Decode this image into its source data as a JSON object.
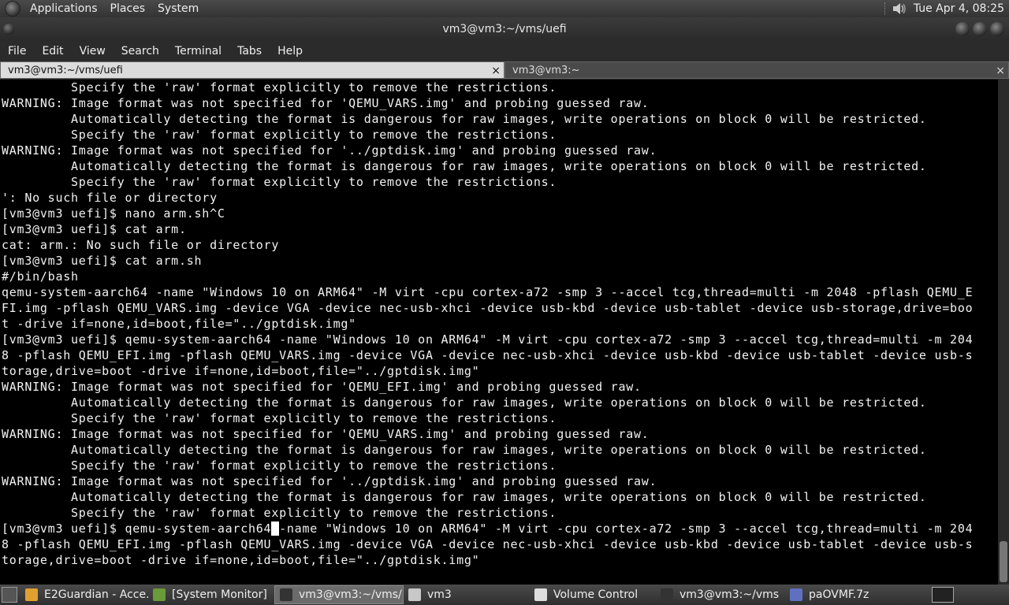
{
  "top_panel": {
    "menus": [
      "Applications",
      "Places",
      "System"
    ],
    "clock": "Tue Apr  4, 08:25",
    "icons": [
      "gnome-foot-icon",
      "speaker-icon"
    ]
  },
  "window": {
    "title": "vm3@vm3:~/vms/uefi"
  },
  "menubar": [
    "File",
    "Edit",
    "View",
    "Search",
    "Terminal",
    "Tabs",
    "Help"
  ],
  "tabs": [
    {
      "label": "vm3@vm3:~/vms/uefi",
      "close": "×"
    },
    {
      "label": "vm3@vm3:~",
      "close": "×"
    }
  ],
  "terminal": {
    "lines": [
      "         Specify the 'raw' format explicitly to remove the restrictions.",
      "WARNING: Image format was not specified for 'QEMU_VARS.img' and probing guessed raw.",
      "         Automatically detecting the format is dangerous for raw images, write operations on block 0 will be restricted.",
      "         Specify the 'raw' format explicitly to remove the restrictions.",
      "WARNING: Image format was not specified for '../gptdisk.img' and probing guessed raw.",
      "         Automatically detecting the format is dangerous for raw images, write operations on block 0 will be restricted.",
      "         Specify the 'raw' format explicitly to remove the restrictions.",
      "': No such file or directory",
      "[vm3@vm3 uefi]$ nano arm.sh^C",
      "[vm3@vm3 uefi]$ cat arm.",
      "cat: arm.: No such file or directory",
      "[vm3@vm3 uefi]$ cat arm.sh",
      "#/bin/bash",
      "qemu-system-aarch64 -name \"Windows 10 on ARM64\" -M virt -cpu cortex-a72 -smp 3 --accel tcg,thread=multi -m 2048 -pflash QEMU_E",
      "FI.img -pflash QEMU_VARS.img -device VGA -device nec-usb-xhci -device usb-kbd -device usb-tablet -device usb-storage,drive=boo",
      "t -drive if=none,id=boot,file=\"../gptdisk.img\"",
      "[vm3@vm3 uefi]$ qemu-system-aarch64 -name \"Windows 10 on ARM64\" -M virt -cpu cortex-a72 -smp 3 --accel tcg,thread=multi -m 204",
      "8 -pflash QEMU_EFI.img -pflash QEMU_VARS.img -device VGA -device nec-usb-xhci -device usb-kbd -device usb-tablet -device usb-s",
      "torage,drive=boot -drive if=none,id=boot,file=\"../gptdisk.img\"",
      "WARNING: Image format was not specified for 'QEMU_EFI.img' and probing guessed raw.",
      "         Automatically detecting the format is dangerous for raw images, write operations on block 0 will be restricted.",
      "         Specify the 'raw' format explicitly to remove the restrictions.",
      "WARNING: Image format was not specified for 'QEMU_VARS.img' and probing guessed raw.",
      "         Automatically detecting the format is dangerous for raw images, write operations on block 0 will be restricted.",
      "         Specify the 'raw' format explicitly to remove the restrictions.",
      "WARNING: Image format was not specified for '../gptdisk.img' and probing guessed raw.",
      "         Automatically detecting the format is dangerous for raw images, write operations on block 0 will be restricted.",
      "         Specify the 'raw' format explicitly to remove the restrictions."
    ],
    "cursor_line": {
      "before": "[vm3@vm3 uefi]$ qemu-system-aarch64",
      "cursor": " ",
      "after": "-name \"Windows 10 on ARM64\" -M virt -cpu cortex-a72 -smp 3 --accel tcg,thread=multi -m 204"
    },
    "tail_lines": [
      "8 -pflash QEMU_EFI.img -pflash QEMU_VARS.img -device VGA -device nec-usb-xhci -device usb-kbd -device usb-tablet -device usb-s",
      "torage,drive=boot -drive if=none,id=boot,file=\"../gptdisk.img\""
    ]
  },
  "taskbar": {
    "items": [
      {
        "label": "E2Guardian - Acce...",
        "icon": "chrome-icon",
        "color": "#e0a030"
      },
      {
        "label": "[System Monitor]",
        "icon": "system-monitor-icon",
        "color": "#6a9a3a"
      },
      {
        "label": "vm3@vm3:~/vms/...",
        "icon": "terminal-icon",
        "color": "#333333"
      },
      {
        "label": "vm3",
        "icon": "folder-icon",
        "color": "#c8c8c8"
      },
      {
        "label": "Volume Control",
        "icon": "volume-icon",
        "color": "#dddddd"
      },
      {
        "label": "vm3@vm3:~/vms",
        "icon": "terminal-icon",
        "color": "#333333"
      },
      {
        "label": "paOVMF.7z",
        "icon": "archive-icon",
        "color": "#6070c0"
      }
    ],
    "active_index": 2
  }
}
